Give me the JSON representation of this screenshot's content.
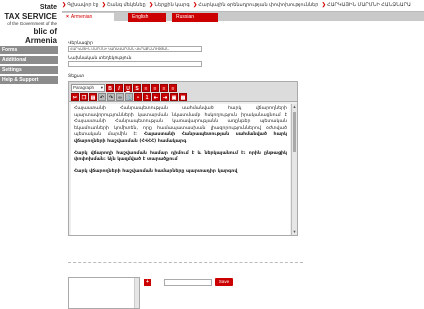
{
  "logo": {
    "line1": "State",
    "line2": "TAX SERVICE",
    "line3": "of the Government of the",
    "line4": "blic of Armenia"
  },
  "breadcrumbs": [
    "Գլխավոր էջ",
    "Շանգ մեկենեը",
    "Ներքին կարգ",
    "Հարկային օրենսդրության փոփոխություններ",
    "ՀԱՐԿԱՅԻՆ ՄԱՐՄՆԻ ՀԱՆՁՆԱՐԱ"
  ],
  "tabs": {
    "active": "Armenian",
    "second": "English",
    "third": "Russian"
  },
  "sidebar": {
    "items": [
      "Forms",
      "Additional",
      "Settings",
      "Help & Support"
    ]
  },
  "form": {
    "title_label": "Վերնագիր",
    "title_value": "ՀԱՐԿԱՅԻՆ ՄԱՐՄՆԻ ԿԱՌԱՎԱՐՄԱՆ ՎԵՐԱՔՆՆՈՒԹՅԱՆ",
    "short_label": "Նախնական տեղեկություն",
    "short_value": "",
    "text_label": "Տեքստ"
  },
  "editor": {
    "format_select": "Paragraph",
    "paragraphs": [
      {
        "plain": "Հայաստանի Հանրապետության սահմանված հարկ վճարողների պարտավորությունների կատարման նկատմամբ հսկողություն իրականացնում է Հայաստանի Հանրապետության կառավարությանն առընթեր պետական եկամուտների կոմիտեն, որը համապատասխան լիազորություններով օժտված պետական մարմին է: ",
        "bold": "Հայաստանի Հանրապետության սահմանված հարկ վճարողների հաշվառման (ՀՎՀՀ) համակարգ"
      },
      {
        "plain": "",
        "bold": "Հարկ վճարողի հաշվառման համար դիմում է և ներկայանում է: որին ընթացիկ փոփոխման: Այն կազմված է տարածքում"
      },
      {
        "plain": "",
        "bold": "Հարկ վճարողների հաշվառման համարները պարտադիր կարգով"
      }
    ]
  },
  "bottom": {
    "save_label": "Save",
    "add_label": "+"
  },
  "colors": {
    "accent": "#cc0000",
    "sidebar": "#8c8c8c",
    "tabbar": "#c9c9c9"
  }
}
